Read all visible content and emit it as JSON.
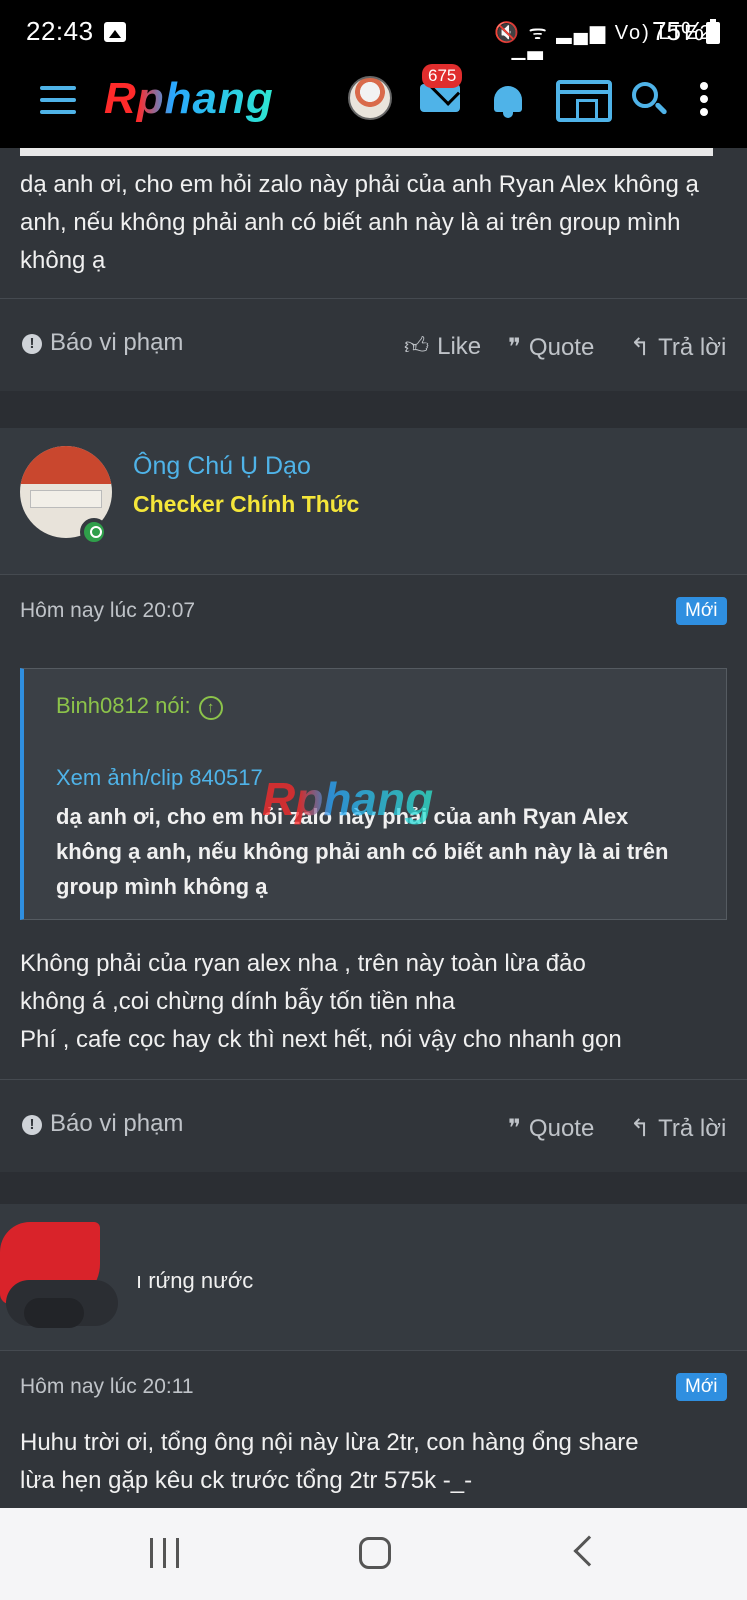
{
  "status_bar": {
    "time": "22:43",
    "system_icons": "🔇 ᯤ ▂▄▆ Vo) LTE2 ▂▄▆",
    "battery": "75%"
  },
  "app_header": {
    "logo": "Rphang",
    "mail_badge": "675",
    "accent_color": "#4fb3e8"
  },
  "posts": [
    {
      "body": "dạ anh ơi, cho em hỏi zalo này phải của anh Ryan Alex không ạ anh, nếu không phải anh có biết anh này là ai trên group mình không ạ",
      "actions": {
        "report": "Báo vi phạm",
        "like": "Like",
        "quote": "Quote",
        "reply": "Trả lời"
      }
    },
    {
      "author": "Ông Chú Ụ Dạo",
      "user_title": "Checker Chính Thức",
      "timestamp": "Hôm nay lúc 20:07",
      "badge": "Mới",
      "quote": {
        "author": "Binh0812 nói:",
        "link": "Xem ảnh/clip 840517",
        "text": "dạ anh ơi, cho em hỏi zalo này phải của anh Ryan Alex không ạ anh, nếu không phải anh có biết anh này là ai trên group mình không ạ"
      },
      "watermark": "Rphang",
      "body_lines": [
        "Không phải của ryan alex nha , trên này toàn lừa đảo",
        "không á ,coi chừng dính bẫy tốn tiền nha",
        "Phí , cafe cọc hay ck thì next hết, nói vậy cho nhanh gọn"
      ],
      "actions": {
        "report": "Báo vi phạm",
        "quote": "Quote",
        "reply": "Trả lời"
      }
    },
    {
      "user_title_partial": "ı rứng nước",
      "timestamp": "Hôm nay lúc 20:11",
      "badge": "Mới",
      "body_lines": [
        "Huhu trời ơi, tổng ông nội này lừa 2tr, con hàng ổng share",
        "lừa hẹn gặp kêu ck trước tổng 2tr 575k -_-"
      ]
    }
  ]
}
